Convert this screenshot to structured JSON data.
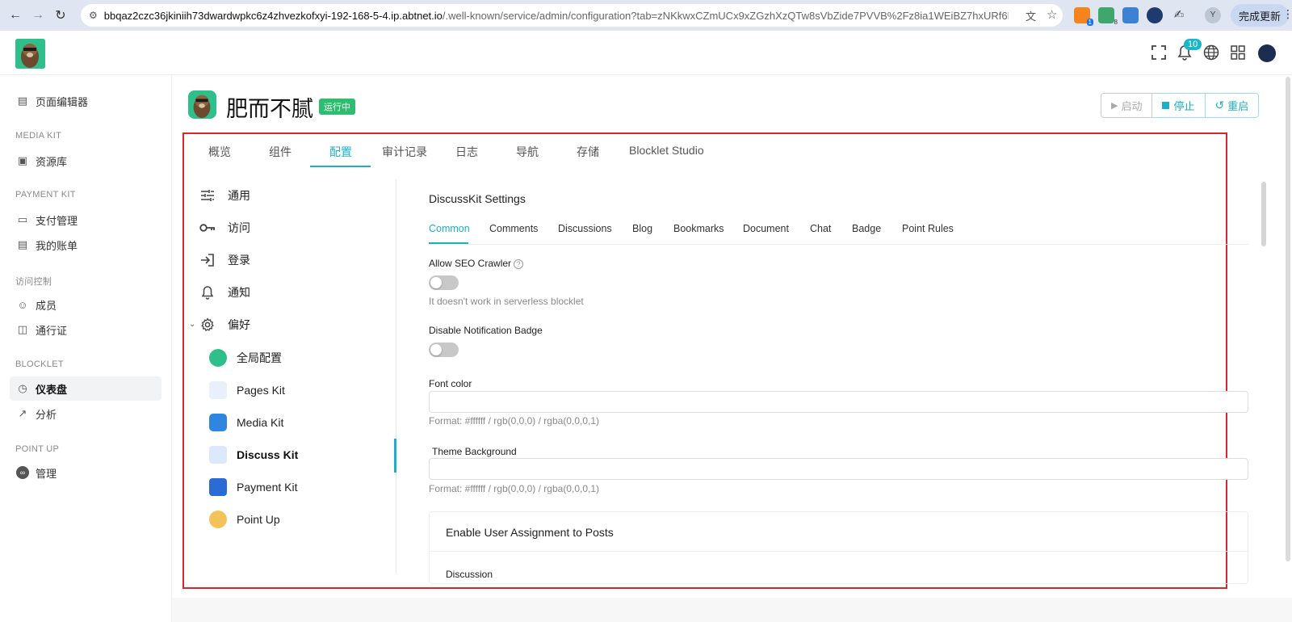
{
  "browser": {
    "url_host": "bbqaz2czc36jkiniih73dwardwpkc6z4zhvezkofxyi-192-168-5-4.ip.abtnet.io",
    "url_path": "/.well-known/service/admin/configuration?tab=zNKkwxCZmUCx9xZGzhXzQTw8sVbZide7PVVB%2Fz8ia1WEiBZ7hxURf6LwH21...",
    "update_label": "完成更新",
    "ext_badge_1": "1",
    "ext_badge_2": "8",
    "profile_initial": "Y"
  },
  "header": {
    "notification_count": "10"
  },
  "sidebar": {
    "items": [
      {
        "label": "页面编辑器",
        "icon": "page-editor-icon"
      },
      {
        "group": "MEDIA KIT"
      },
      {
        "label": "资源库",
        "icon": "gallery-icon"
      },
      {
        "group": "PAYMENT KIT"
      },
      {
        "label": "支付管理",
        "icon": "payment-icon"
      },
      {
        "label": "我的账单",
        "icon": "bill-icon"
      },
      {
        "group": "访问控制"
      },
      {
        "label": "成员",
        "icon": "user-icon"
      },
      {
        "label": "通行证",
        "icon": "passport-icon"
      },
      {
        "group": "BLOCKLET"
      },
      {
        "label": "仪表盘",
        "icon": "dashboard-icon",
        "active": true
      },
      {
        "label": "分析",
        "icon": "analytics-icon"
      },
      {
        "group": "POINT UP"
      },
      {
        "label": "管理",
        "icon": "manage-icon"
      }
    ]
  },
  "main": {
    "title": "肥而不腻",
    "status": "运行中",
    "actions": {
      "start": "启动",
      "stop": "停止",
      "restart": "重启"
    },
    "tabs": [
      "概览",
      "组件",
      "配置",
      "审计记录",
      "日志",
      "导航",
      "存储",
      "Blocklet Studio"
    ],
    "active_tab": "配置"
  },
  "config_menu": {
    "items": [
      "通用",
      "访问",
      "登录",
      "通知",
      "偏好"
    ],
    "sub_items": [
      "全局配置",
      "Pages Kit",
      "Media Kit",
      "Discuss Kit",
      "Payment Kit",
      "Point Up"
    ],
    "active_sub": "Discuss Kit"
  },
  "settings": {
    "title": "DiscussKit Settings",
    "tabs": [
      "Common",
      "Comments",
      "Discussions",
      "Blog",
      "Bookmarks",
      "Document",
      "Chat",
      "Badge",
      "Point Rules"
    ],
    "active_tab": "Common",
    "seo_label": "Allow SEO Crawler",
    "seo_hint": "It doesn't work in serverless blocklet",
    "seo_enabled": false,
    "badge_label": "Disable Notification Badge",
    "badge_enabled": false,
    "font_color_label": "Font color",
    "font_color_value": "",
    "format_hint": "Format: #ffffff / rgb(0,0,0) / rgba(0,0,0,1)",
    "theme_bg_label": "Theme Background",
    "theme_bg_value": "",
    "card_title": "Enable User Assignment to Posts",
    "card_sub": "Discussion"
  },
  "colors": {
    "accent": "#1bb0c8",
    "status": "#2dbd6e",
    "highlight": "#d9262c"
  }
}
